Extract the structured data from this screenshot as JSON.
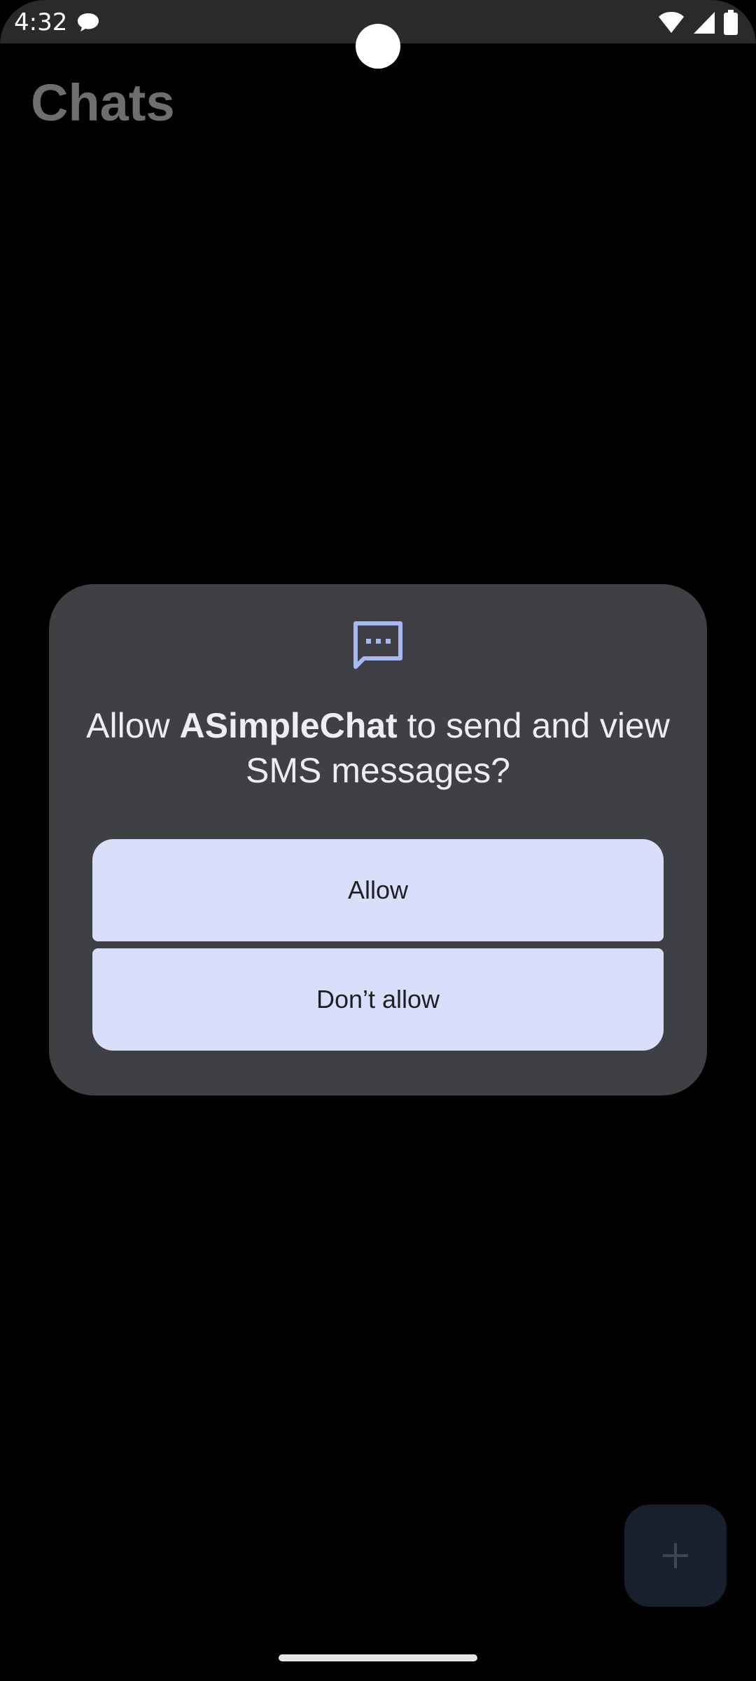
{
  "status_bar": {
    "time": "4:32",
    "notification_icon": "chat-bubble-icon",
    "icons": [
      "wifi-icon",
      "signal-icon",
      "battery-icon"
    ]
  },
  "app": {
    "title": "Chats"
  },
  "dialog": {
    "icon": "sms-message-icon",
    "message_prefix": "Allow ",
    "app_name": "ASimpleChat",
    "message_suffix": " to send and view SMS messages?",
    "allow_label": "Allow",
    "deny_label": "Don’t allow"
  },
  "fab": {
    "icon": "plus-icon"
  },
  "colors": {
    "dialog_bg": "#3e4044",
    "button_bg": "#d9defb",
    "icon_accent": "#a6b8f2",
    "fab_bg": "#18202e"
  }
}
